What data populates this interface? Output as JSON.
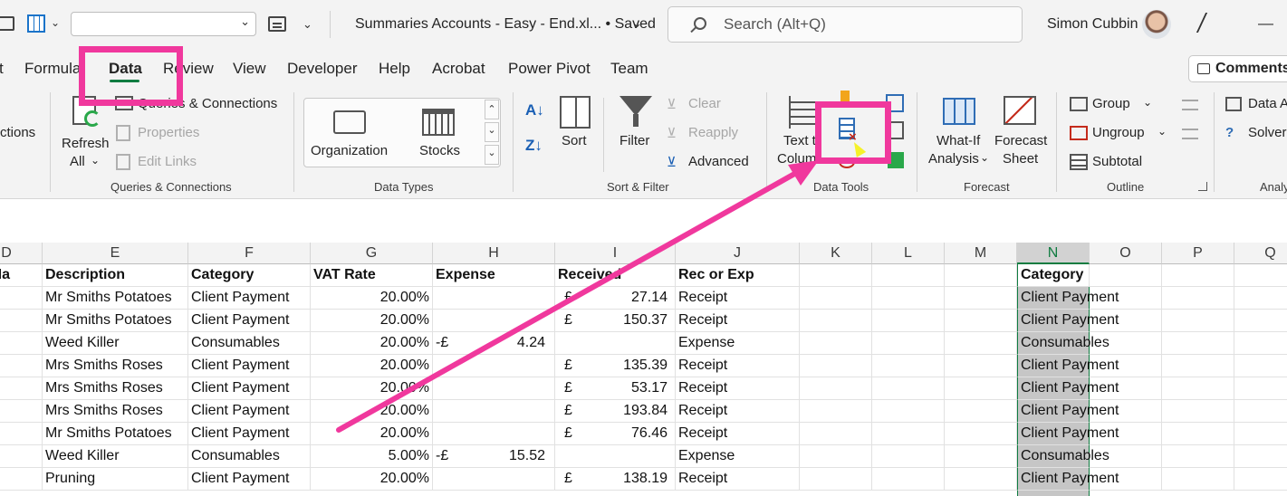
{
  "titlebar": {
    "file_title": "Summaries Accounts - Easy - End.xl... • Saved",
    "search_placeholder": "Search (Alt+Q)",
    "user_name": "Simon Cubbin",
    "minimize": "—"
  },
  "tabs": [
    "t",
    "Formula",
    "Data",
    "Review",
    "View",
    "Developer",
    "Help",
    "Acrobat",
    "Power Pivot",
    "Team"
  ],
  "comments_label": "Comments",
  "ribbon": {
    "connections_partial": "ctions",
    "refresh_all": [
      "Refresh",
      "All"
    ],
    "queries_connections": "Queries & Connections",
    "properties": "Properties",
    "edit_links": "Edit Links",
    "group_queries": "Queries & Connections",
    "organization": "Organization",
    "stocks": "Stocks",
    "group_datatypes": "Data Types",
    "sort": "Sort",
    "filter": "Filter",
    "clear": "Clear",
    "reapply": "Reapply",
    "advanced": "Advanced",
    "group_sortfilter": "Sort & Filter",
    "text_to_columns": [
      "Text to",
      "Columns"
    ],
    "group_datatools": "Data Tools",
    "whatif": [
      "What-If",
      "Analysis"
    ],
    "forecast_sheet": [
      "Forecast",
      "Sheet"
    ],
    "group_forecast": "Forecast",
    "group": "Group",
    "ungroup": "Ungroup",
    "subtotal": "Subtotal",
    "group_outline": "Outline",
    "data_analysis": "Data A",
    "solver": "Solver",
    "group_analysis": "Analy"
  },
  "columns": [
    "D",
    "E",
    "F",
    "G",
    "H",
    "I",
    "J",
    "K",
    "L",
    "M",
    "N",
    "O",
    "P",
    "Q"
  ],
  "headers": {
    "D": "th Na",
    "E": "Description",
    "F": "Category",
    "G": "VAT Rate",
    "H": "Expense",
    "I": "Received",
    "J": "Rec or Exp",
    "N": "Category"
  },
  "rows": [
    {
      "desc": "Mr Smiths Potatoes",
      "cat": "Client Payment",
      "vat": "20.00%",
      "exp_sign": "",
      "exp": "",
      "rec_sign": "£",
      "rec": "27.14",
      "recexp": "Receipt",
      "n": "Client Payment"
    },
    {
      "desc": "Mr Smiths Potatoes",
      "cat": "Client Payment",
      "vat": "20.00%",
      "exp_sign": "",
      "exp": "",
      "rec_sign": "£",
      "rec": "150.37",
      "recexp": "Receipt",
      "n": "Client Payment"
    },
    {
      "desc": "Weed Killer",
      "cat": "Consumables",
      "vat": "20.00%",
      "exp_sign": "-£",
      "exp": "4.24",
      "rec_sign": "",
      "rec": "",
      "recexp": "Expense",
      "n": "Consumables"
    },
    {
      "desc": "Mrs Smiths Roses",
      "cat": "Client Payment",
      "vat": "20.00%",
      "exp_sign": "",
      "exp": "",
      "rec_sign": "£",
      "rec": "135.39",
      "recexp": "Receipt",
      "n": "Client Payment"
    },
    {
      "desc": "Mrs Smiths Roses",
      "cat": "Client Payment",
      "vat": "20.00%",
      "exp_sign": "",
      "exp": "",
      "rec_sign": "£",
      "rec": "53.17",
      "recexp": "Receipt",
      "n": "Client Payment"
    },
    {
      "desc": "Mrs Smiths Roses",
      "cat": "Client Payment",
      "vat": "20.00%",
      "exp_sign": "",
      "exp": "",
      "rec_sign": "£",
      "rec": "193.84",
      "recexp": "Receipt",
      "n": "Client Payment"
    },
    {
      "desc": "Mr Smiths Potatoes",
      "cat": "Client Payment",
      "vat": "20.00%",
      "exp_sign": "",
      "exp": "",
      "rec_sign": "£",
      "rec": "76.46",
      "recexp": "Receipt",
      "n": "Client Payment"
    },
    {
      "desc": "Weed Killer",
      "cat": "Consumables",
      "vat": "5.00%",
      "exp_sign": "-£",
      "exp": "15.52",
      "rec_sign": "",
      "rec": "",
      "recexp": "Expense",
      "n": "Consumables"
    },
    {
      "desc": "Pruning",
      "cat": "Client Payment",
      "vat": "20.00%",
      "exp_sign": "",
      "exp": "",
      "rec_sign": "£",
      "rec": "138.19",
      "recexp": "Receipt",
      "n": "Client Payment"
    }
  ],
  "colors": {
    "excel_green": "#107c41",
    "highlight_pink": "#f0389d",
    "selected_column": "#c6c6c6"
  }
}
